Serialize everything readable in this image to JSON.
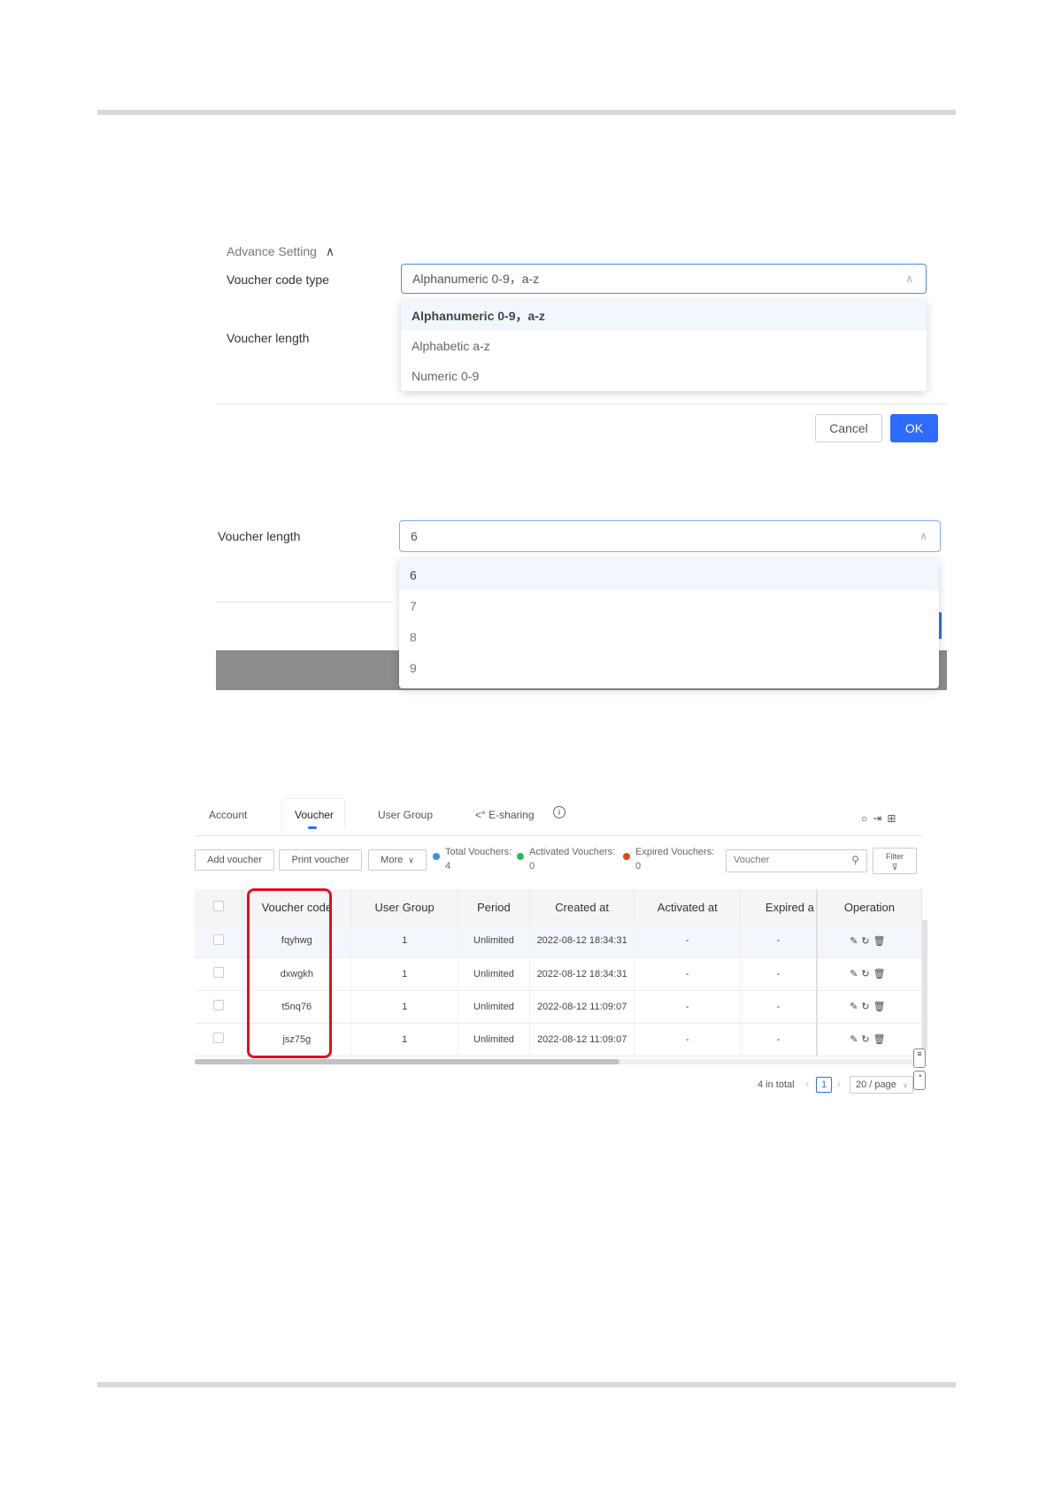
{
  "panel1": {
    "advance_setting": "Advance Setting",
    "code_type_label": "Voucher code type",
    "code_type_value": "Alphanumeric 0-9，a-z",
    "code_type_options": [
      "Alphanumeric 0-9，a-z",
      "Alphabetic a-z",
      "Numeric 0-9"
    ],
    "length_label": "Voucher length",
    "cancel": "Cancel",
    "ok": "OK"
  },
  "panel2": {
    "length_label": "Voucher length",
    "length_value": "6",
    "length_options": [
      "6",
      "7",
      "8",
      "9"
    ]
  },
  "panel3": {
    "tabs": [
      "Account",
      "Voucher",
      "User Group",
      "E-sharing"
    ],
    "buttons": {
      "add": "Add voucher",
      "print": "Print voucher",
      "more": "More"
    },
    "stats": [
      {
        "label": "Total Vouchers:",
        "value": "4",
        "color": "#3b8fe8"
      },
      {
        "label": "Activated Vouchers:",
        "value": "0",
        "color": "#1fbf5f"
      },
      {
        "label": "Expired Vouchers:",
        "value": "0",
        "color": "#e8421e"
      }
    ],
    "search_placeholder": "Voucher",
    "filter_label": "Filter",
    "columns": [
      "Voucher code",
      "User Group",
      "Period",
      "Created at",
      "Activated at",
      "Expired a",
      "Operation"
    ],
    "rows": [
      {
        "code": "fqyhwg",
        "group": "1",
        "period": "Unlimited",
        "created": "2022-08-12 18:34:31",
        "activated": "-",
        "expired": "-"
      },
      {
        "code": "dxwgkh",
        "group": "1",
        "period": "Unlimited",
        "created": "2022-08-12 18:34:31",
        "activated": "-",
        "expired": "-"
      },
      {
        "code": "t5nq76",
        "group": "1",
        "period": "Unlimited",
        "created": "2022-08-12 11:09:07",
        "activated": "-",
        "expired": "-"
      },
      {
        "code": "jsz75g",
        "group": "1",
        "period": "Unlimited",
        "created": "2022-08-12 11:09:07",
        "activated": "-",
        "expired": "-"
      }
    ],
    "pagination": {
      "total": "4 in total",
      "page": "1",
      "page_size": "20 / page"
    }
  }
}
